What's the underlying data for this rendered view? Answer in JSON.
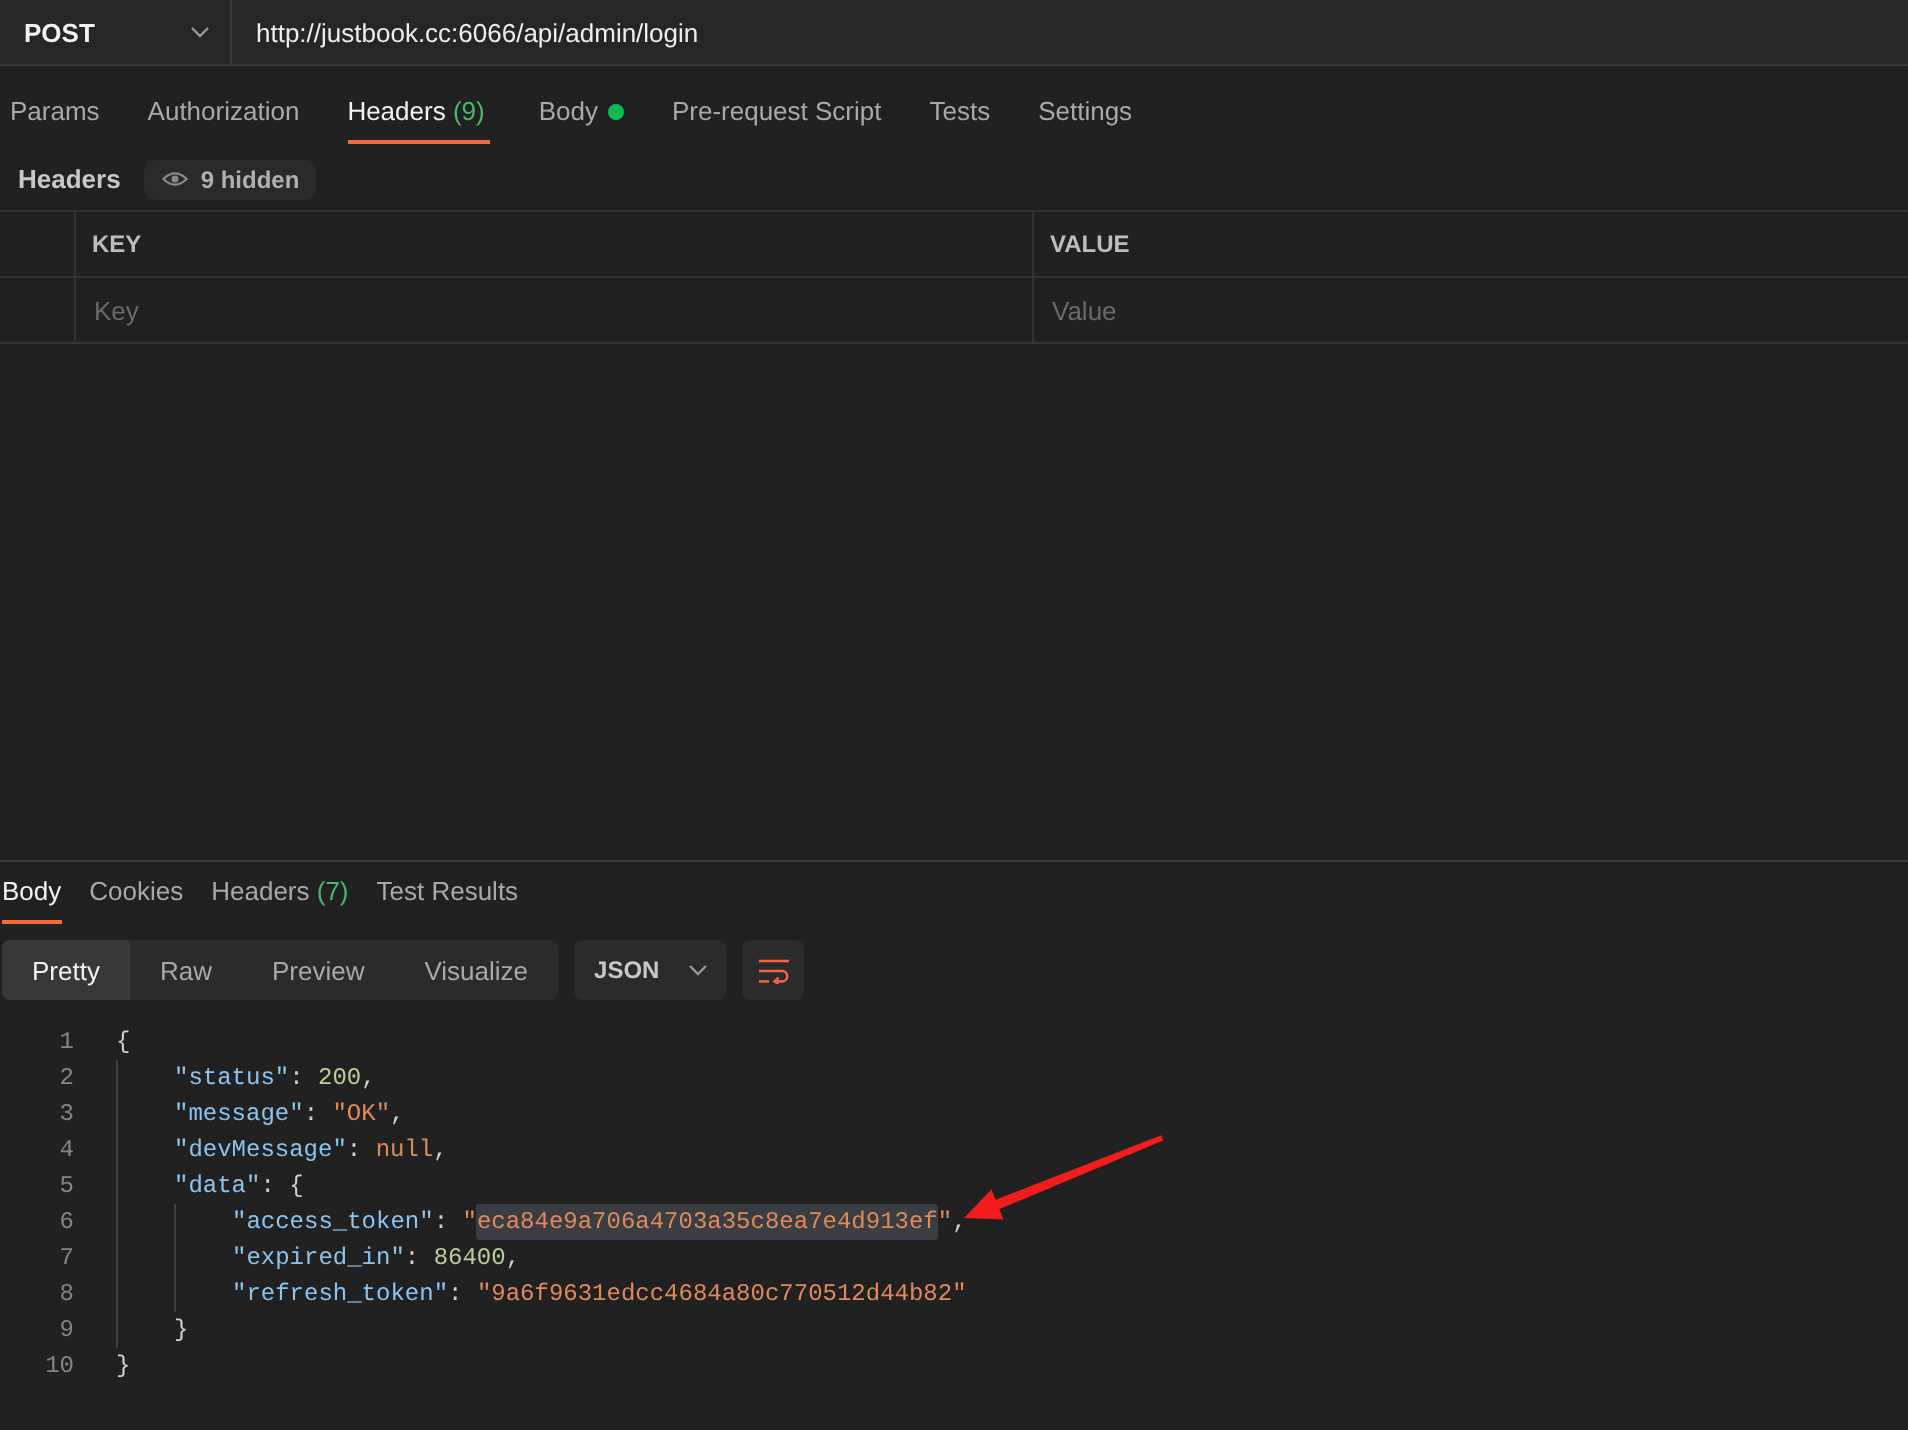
{
  "request": {
    "method": "POST",
    "url": "http://justbook.cc:6066/api/admin/login"
  },
  "request_tabs": [
    {
      "label": "Params",
      "selected": false,
      "dot": false
    },
    {
      "label": "Authorization",
      "selected": false,
      "dot": false
    },
    {
      "label": "Headers",
      "count": "(9)",
      "selected": true,
      "dot": false
    },
    {
      "label": "Body",
      "selected": false,
      "dot": true
    },
    {
      "label": "Pre-request Script",
      "selected": false,
      "dot": false
    },
    {
      "label": "Tests",
      "selected": false,
      "dot": false
    },
    {
      "label": "Settings",
      "selected": false,
      "dot": false
    }
  ],
  "headers_bar": {
    "title": "Headers",
    "hidden_badge": "9 hidden"
  },
  "headers_table": {
    "columns": [
      "KEY",
      "VALUE"
    ],
    "rows": [
      {
        "key_placeholder": "Key",
        "value_placeholder": "Value"
      }
    ]
  },
  "response_tabs": [
    {
      "label": "Body",
      "selected": true
    },
    {
      "label": "Cookies",
      "selected": false
    },
    {
      "label": "Headers",
      "count": "(7)",
      "selected": false
    },
    {
      "label": "Test Results",
      "selected": false
    }
  ],
  "view_modes": [
    {
      "label": "Pretty",
      "selected": true
    },
    {
      "label": "Raw",
      "selected": false
    },
    {
      "label": "Preview",
      "selected": false
    },
    {
      "label": "Visualize",
      "selected": false
    }
  ],
  "format_select": {
    "value": "JSON"
  },
  "code": [
    {
      "number": "1",
      "tokens": [
        {
          "kind": "punct",
          "text": "{"
        }
      ],
      "children": [
        {
          "number": "2",
          "tokens": [
            {
              "kind": "key",
              "text": "\"status\""
            },
            {
              "kind": "punct",
              "text": ": "
            },
            {
              "kind": "number",
              "text": "200"
            },
            {
              "kind": "punct",
              "text": ","
            }
          ]
        },
        {
          "number": "3",
          "tokens": [
            {
              "kind": "key",
              "text": "\"message\""
            },
            {
              "kind": "punct",
              "text": ": "
            },
            {
              "kind": "string",
              "text": "\"OK\""
            },
            {
              "kind": "punct",
              "text": ","
            }
          ]
        },
        {
          "number": "4",
          "tokens": [
            {
              "kind": "key",
              "text": "\"devMessage\""
            },
            {
              "kind": "punct",
              "text": ": "
            },
            {
              "kind": "null",
              "text": "null"
            },
            {
              "kind": "punct",
              "text": ","
            }
          ]
        },
        {
          "number": "5",
          "tokens": [
            {
              "kind": "key",
              "text": "\"data\""
            },
            {
              "kind": "punct",
              "text": ": {"
            }
          ],
          "children": [
            {
              "number": "6",
              "tokens": [
                {
                  "kind": "key",
                  "text": "\"access_token\""
                },
                {
                  "kind": "punct",
                  "text": ": "
                },
                {
                  "kind": "string",
                  "text": "\""
                },
                {
                  "kind": "highlight",
                  "text": "eca84e9a706a4703a35c8ea7e4d913ef"
                },
                {
                  "kind": "string",
                  "text": "\""
                },
                {
                  "kind": "punct",
                  "text": ","
                }
              ]
            },
            {
              "number": "7",
              "tokens": [
                {
                  "kind": "key",
                  "text": "\"expired_in\""
                },
                {
                  "kind": "punct",
                  "text": ": "
                },
                {
                  "kind": "number",
                  "text": "86400"
                },
                {
                  "kind": "punct",
                  "text": ","
                }
              ]
            },
            {
              "number": "8",
              "tokens": [
                {
                  "kind": "key",
                  "text": "\"refresh_token\""
                },
                {
                  "kind": "punct",
                  "text": ": "
                },
                {
                  "kind": "string",
                  "text": "\"9a6f9631edcc4684a80c770512d44b82\""
                }
              ]
            }
          ]
        },
        {
          "number": "9",
          "tokens": [
            {
              "kind": "punct",
              "text": "}"
            }
          ]
        }
      ]
    },
    {
      "number": "10",
      "tokens": [
        {
          "kind": "punct",
          "text": "}"
        }
      ]
    }
  ]
}
